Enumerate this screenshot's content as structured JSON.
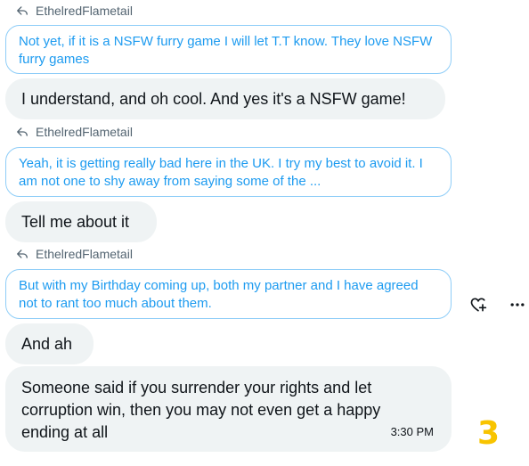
{
  "messages": [
    {
      "reply_to": "EthelredFlametail",
      "quote": "Not yet, if it is a NSFW furry game I will let T.T know. They love NSFW furry games",
      "text": "I understand, and oh cool. And yes it's a NSFW game!"
    },
    {
      "reply_to": "EthelredFlametail",
      "quote": "Yeah, it is getting really bad here in the UK. I try my best to avoid it. I am not one to shy away from saying some of the ...",
      "text": "Tell me about it"
    },
    {
      "reply_to": "EthelredFlametail",
      "quote": "But with my Birthday coming up, both my partner and I have agreed not to rant too much about them.",
      "text": "And ah"
    },
    {
      "text_lines": [
        "Someone said if you surrender your rights and let",
        "corruption win, then you may not even get a happy",
        "ending at all"
      ],
      "time": "3:30 PM"
    }
  ],
  "actions": {
    "react_icon": "add-reaction-icon",
    "more_icon": "more-options-icon"
  },
  "overlay_label": "3",
  "colors": {
    "accent": "#1d9bf0",
    "bubble": "#eff3f4",
    "quote_border": "#8ecdf8",
    "overlay": "#f8c400"
  }
}
